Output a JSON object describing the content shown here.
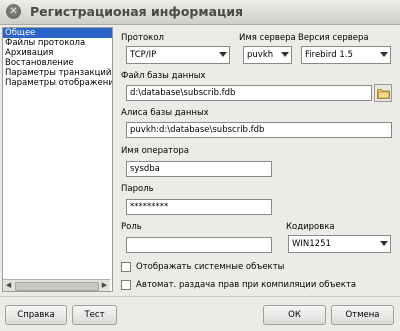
{
  "window": {
    "title": "Регистрационая информация",
    "close_glyph": "✕"
  },
  "sidebar": {
    "items": [
      {
        "label": "Общее",
        "selected": true
      },
      {
        "label": "Файлы протокола",
        "selected": false
      },
      {
        "label": "Архивация",
        "selected": false
      },
      {
        "label": "Востановление",
        "selected": false
      },
      {
        "label": "Параметры транзакций",
        "selected": false
      },
      {
        "label": "Параметры отображения",
        "selected": false
      }
    ]
  },
  "form": {
    "protocol": {
      "label": "Протокол",
      "value": "TCP/IP"
    },
    "server_name": {
      "label": "Имя сервера",
      "value": "puvkh"
    },
    "server_version": {
      "label": "Версия сервера",
      "value": "Firebird 1.5"
    },
    "db_file": {
      "label": "Файл базы данных",
      "value": "d:\\database\\subscrib.fdb"
    },
    "db_alias": {
      "label": "Алиса базы данных",
      "value": "puvkh:d:\\database\\subscrib.fdb"
    },
    "operator": {
      "label": "Имя оператора",
      "value": "sysdba"
    },
    "password": {
      "label": "Пароль",
      "value": "*********"
    },
    "role": {
      "label": "Роль",
      "value": ""
    },
    "encoding": {
      "label": "Кодировка",
      "value": "WIN1251"
    },
    "show_system_objects": {
      "label": "Отображать системные объекты",
      "checked": false
    },
    "auto_grant": {
      "label": "Автомат. раздача прав при компиляции объекта",
      "checked": false
    }
  },
  "buttons": {
    "help": "Справка",
    "test": "Тест",
    "ok": "ОК",
    "cancel": "Отмена"
  }
}
